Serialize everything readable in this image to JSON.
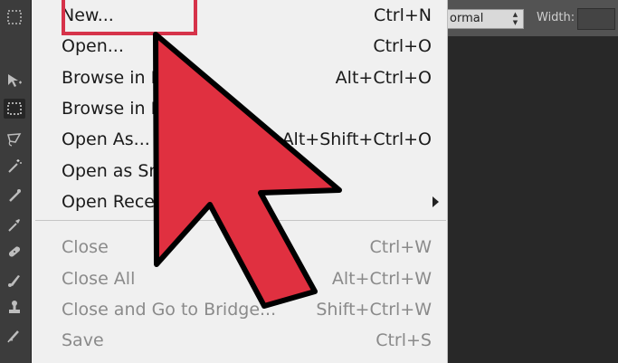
{
  "menu": {
    "items": [
      {
        "label": "New...",
        "shortcut": "Ctrl+N",
        "enabled": true
      },
      {
        "label": "Open...",
        "shortcut": "Ctrl+O",
        "enabled": true
      },
      {
        "label": "Browse in B",
        "shortcut": "Alt+Ctrl+O",
        "enabled": true
      },
      {
        "label": "Browse in M",
        "shortcut": "",
        "enabled": true
      },
      {
        "label": "Open As...",
        "shortcut": "Alt+Shift+Ctrl+O",
        "enabled": true
      },
      {
        "label": "Open as Sm",
        "shortcut": "",
        "enabled": true
      },
      {
        "label": "Open Rece",
        "shortcut": "",
        "enabled": true,
        "submenu": true
      },
      {
        "label": "Close",
        "shortcut": "Ctrl+W",
        "enabled": false
      },
      {
        "label": "Close All",
        "shortcut": "Alt+Ctrl+W",
        "enabled": false
      },
      {
        "label": "Close and Go to Bridge...",
        "shortcut": "Shift+Ctrl+W",
        "enabled": false
      },
      {
        "label": "Save",
        "shortcut": "Ctrl+S",
        "enabled": false
      }
    ]
  },
  "options_bar": {
    "blend_mode": "ormal",
    "width_label": "Width:"
  },
  "tools": [
    "marquee-icon",
    "move-icon",
    "rect-marquee-icon",
    "lasso-icon",
    "magic-wand-icon",
    "crop-icon",
    "eyedropper-icon",
    "healing-icon",
    "brush-icon",
    "stamp-icon",
    "history-brush-icon"
  ],
  "colors": {
    "highlight": "#d6334a",
    "arrow_fill": "#e03040",
    "menu_bg": "#f0f0f0",
    "disabled_text": "#8a8a8a"
  }
}
